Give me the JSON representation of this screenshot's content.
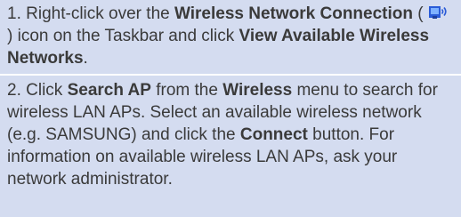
{
  "steps": [
    {
      "num": "1.",
      "t1": "Right-click over the",
      "b1": "Wireless Network Connection",
      "t2": "(",
      "icon": "wireless-network-icon",
      "t3": ") icon on the Taskbar and click",
      "b2": "View Available Wireless Networks",
      "t4": "."
    },
    {
      "num": "2.",
      "t1": "Click",
      "b1": "Search AP",
      "t2": "from the",
      "b2": "Wireless",
      "t3": "menu to search for wireless LAN APs. Select an available wireless network (e.g. SAMSUNG) and click the",
      "b3": "Connect",
      "t4": "button. For information on available wireless LAN APs, ask your network administrator."
    }
  ],
  "colors": {
    "background": "#d4dcf0",
    "text": "#3a3a3a",
    "divider": "#ffffff",
    "icon_blue": "#2a5bd7"
  }
}
